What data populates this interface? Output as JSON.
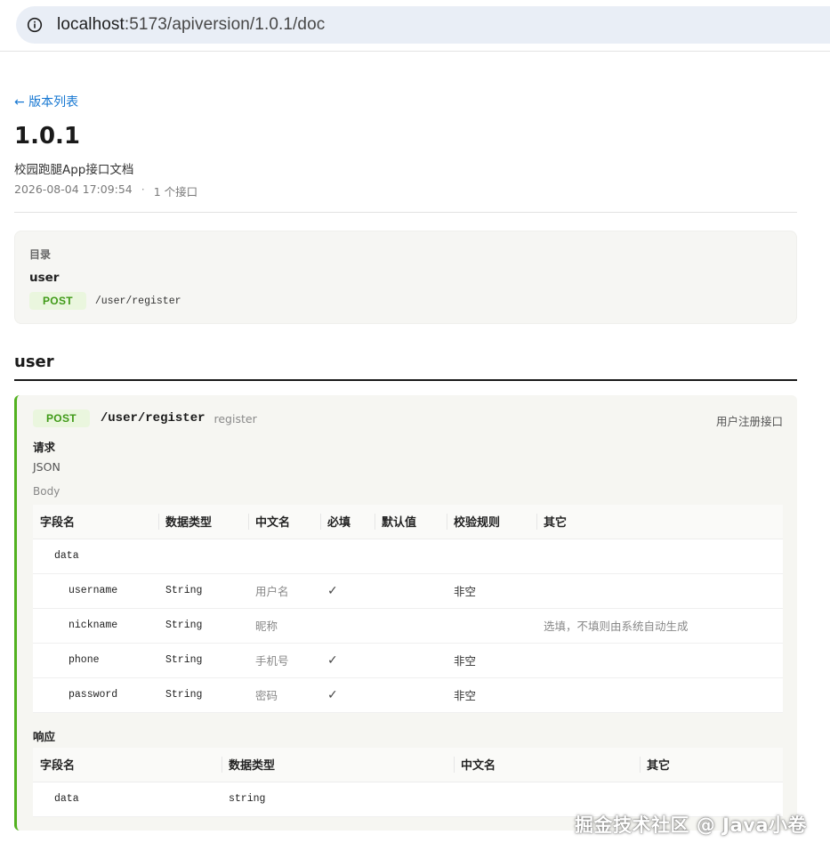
{
  "browser": {
    "url_host": "localhost",
    "url_rest": ":5173/apiversion/1.0.1/doc"
  },
  "page": {
    "back_link": "← 版本列表",
    "version": "1.0.1",
    "description": "校园跑腿App接口文档",
    "timestamp": "2026-08-04 17:09:54",
    "separator": "·",
    "count": "1 个接口"
  },
  "toc": {
    "title": "目录",
    "group": "user",
    "items": [
      {
        "method": "POST",
        "path": "/user/register"
      }
    ]
  },
  "section": {
    "title": "user"
  },
  "api": {
    "method": "POST",
    "path": "/user/register",
    "name": "register",
    "summary": "用户注册接口",
    "request_label": "请求",
    "request_type": "JSON",
    "body_label": "Body",
    "request_headers": [
      "字段名",
      "数据类型",
      "中文名",
      "必填",
      "默认值",
      "校验规则",
      "其它"
    ],
    "request_rows": [
      {
        "field": "data",
        "type": "",
        "cn": "",
        "required": "",
        "default": "",
        "rule": "",
        "other": "",
        "level": 1
      },
      {
        "field": "username",
        "type": "String",
        "cn": "用户名",
        "required": "✓",
        "default": "",
        "rule": "非空",
        "other": "",
        "level": 2
      },
      {
        "field": "nickname",
        "type": "String",
        "cn": "昵称",
        "required": "",
        "default": "",
        "rule": "",
        "other": "选填，不填则由系统自动生成",
        "level": 2
      },
      {
        "field": "phone",
        "type": "String",
        "cn": "手机号",
        "required": "✓",
        "default": "",
        "rule": "非空",
        "other": "",
        "level": 2
      },
      {
        "field": "password",
        "type": "String",
        "cn": "密码",
        "required": "✓",
        "default": "",
        "rule": "非空",
        "other": "",
        "level": 2
      }
    ],
    "response_label": "响应",
    "response_headers": [
      "字段名",
      "数据类型",
      "中文名",
      "其它"
    ],
    "response_rows": [
      {
        "field": "data",
        "type": "string",
        "cn": "",
        "other": ""
      }
    ]
  },
  "watermark": "掘金技术社区 @ Java小卷",
  "colors": {
    "accent_green": "#52b11f",
    "link_blue": "#1677d2",
    "badge_bg": "#eaf6de",
    "badge_text": "#3f9a17"
  }
}
